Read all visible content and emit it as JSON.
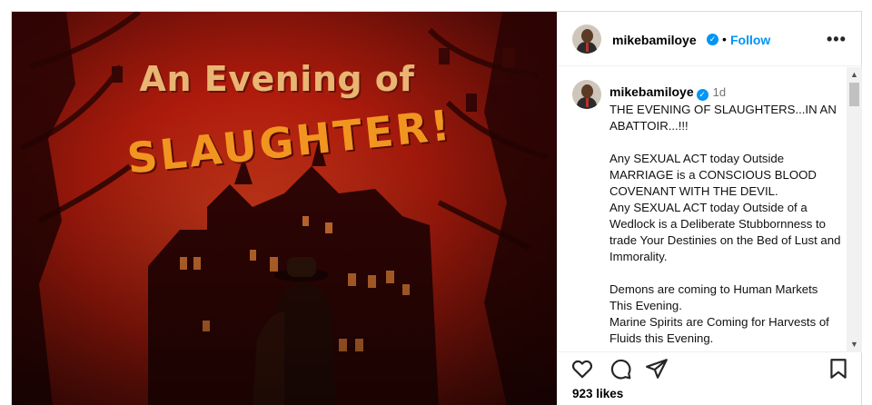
{
  "post": {
    "image": {
      "title_line1": "An Evening of",
      "title_line2": "SLAUGHTER!"
    },
    "author": {
      "username": "mikebamiloye",
      "verified": true,
      "follow_label": "Follow",
      "separator": "•",
      "more_label": "•••"
    },
    "caption": {
      "username": "mikebamiloye",
      "time": "1d",
      "text": "THE EVENING OF SLAUGHTERS...IN AN ABATTOIR...!!!\n\nAny SEXUAL ACT today Outside MARRIAGE is a CONSCIOUS BLOOD COVENANT WITH THE DEVIL.\nAny SEXUAL ACT today Outside of a Wedlock is a Deliberate Stubbornness to trade Your Destinies on the Bed of Lust and Immorality.\n\nDemons are coming to Human Markets This Evening.\nMarine Spirits are Coming for Harvests of Fluids this Evening."
    },
    "actions": {
      "like_icon": "heart-icon",
      "comment_icon": "comment-icon",
      "share_icon": "send-icon",
      "save_icon": "bookmark-icon"
    },
    "likes": "923 likes"
  },
  "colors": {
    "accent": "#0095f6",
    "poster_title": "#e9b573",
    "poster_subtitle": "#f19520"
  }
}
